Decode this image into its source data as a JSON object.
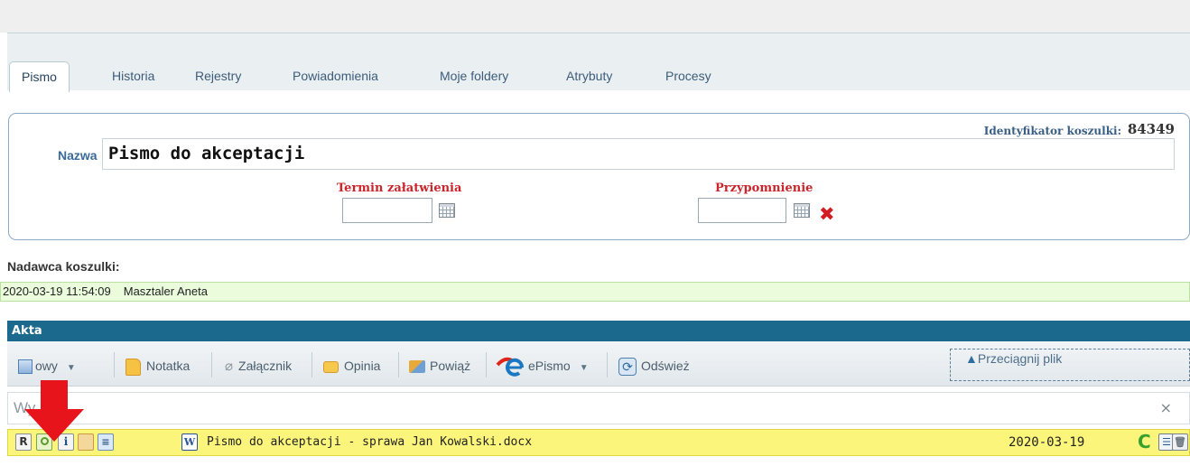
{
  "tabs": [
    "Pismo",
    "Historia",
    "Rejestry",
    "Powiadomienia",
    "Moje foldery",
    "Atrybuty",
    "Procesy"
  ],
  "active_tab": "Pismo",
  "form": {
    "id_label": "Identyfikator koszulki:",
    "id_value": "84349",
    "name_label": "Nazwa",
    "name_value": "Pismo do akceptacji",
    "due_label": "Termin załatwienia",
    "due_value": "",
    "reminder_label": "Przypomnienie",
    "reminder_value": ""
  },
  "sender": {
    "title": "Nadawca koszulki:",
    "datetime": "2020-03-19 11:54:09",
    "name": "Masztaler Aneta"
  },
  "akta": {
    "header": "Akta",
    "toolbar": {
      "new_label": "owy",
      "note_label": "Notatka",
      "attachment_label": "Załącznik",
      "opinion_label": "Opinia",
      "link_label": "Powiąż",
      "epismo_label": "ePismo",
      "refresh_label": "Odśwież"
    },
    "dropzone_label": "Przeciągnij plik",
    "search_text": "Wy   ukaj",
    "clear_symbol": "×",
    "files": [
      {
        "name": "Pismo do akceptacji - sprawa Jan Kowalski.docx",
        "date": "2020-03-19",
        "type_icon": "word-doc-icon"
      }
    ]
  },
  "colors": {
    "accent": "#1b6a8e",
    "required_label": "#c9252b",
    "file_row": "#fbf57b",
    "sender_row": "#eafcdc",
    "annotation_arrow": "#e8141c"
  }
}
